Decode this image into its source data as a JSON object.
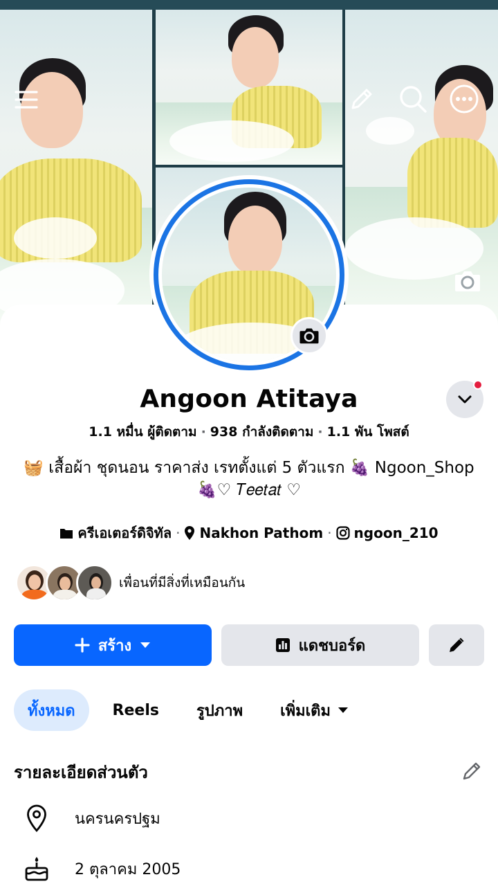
{
  "header": {
    "menu_icon": "hamburger-menu-icon",
    "edit_icon": "pencil-icon",
    "search_icon": "search-icon",
    "more_icon": "more-options-icon",
    "cover_camera_icon": "camera-icon"
  },
  "profile": {
    "name": "Angoon Atitaya",
    "followers": "1.1 หมื่น ผู้ติดตาม",
    "following": "938 กำลังติดตาม",
    "posts": "1.1 พัน โพสต์",
    "stats_separator": "·",
    "bio_line1": "🧺 เสื้อผ้า ชุดนอน ราคาส่ง เรทตั้งแต่ 5 ตัวแรก 🍇 Ngoon_Shop",
    "bio_line2": "🍇♡ 𝑇𝑒𝑒𝑡𝑎𝑡 ♡",
    "category": "ครีเอเตอร์ดิจิทัล",
    "location": "Nakhon Pathom",
    "instagram": "ngoon_210",
    "meta_separator": "·",
    "mutual_text": "เพื่อนที่มีสิ่งที่เหมือนกัน"
  },
  "actions": {
    "create_label": "สร้าง",
    "dashboard_label": "แดชบอร์ด"
  },
  "tabs": [
    {
      "label": "ทั้งหมด",
      "active": true
    },
    {
      "label": "Reels",
      "active": false
    },
    {
      "label": "รูปภาพ",
      "active": false
    },
    {
      "label": "เพิ่มเติม",
      "active": false
    }
  ],
  "details": {
    "title": "รายละเอียดส่วนตัว",
    "location": "นครนครปฐม",
    "birthday": "2 ตุลาคม  2005"
  },
  "colors": {
    "accent": "#0866ff",
    "ring": "#1b74e4",
    "notification": "#e41e3f",
    "secondary_bg": "#e4e6eb",
    "tab_active_bg": "#ddebfd"
  }
}
